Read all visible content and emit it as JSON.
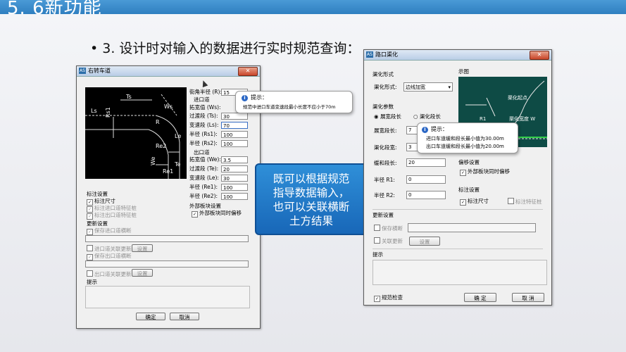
{
  "slide": {
    "header_title": "5. 6新功能",
    "bullet_marker": "•",
    "bullet_text": "3. 设计时对输入的数据进行实时规范查询："
  },
  "left_dialog": {
    "title": "右转车道",
    "params": {
      "corner_radius_label": "街角半径 (R):",
      "corner_radius_value": "15",
      "entry_label": "进口道",
      "widen_label": "拓宽值 (Ws):",
      "taper_label": "过渡段 (Ts):",
      "taper_value": "30",
      "change_label": "变速段 (Ls):",
      "change_value": "70",
      "r1_label": "半径 (Rs1):",
      "r1_value": "100",
      "r2_label": "半径 (Rs2):",
      "r2_value": "100",
      "exit_label": "出口道",
      "e_widen_label": "拓宽值 (We):",
      "e_widen_value": "3.5",
      "e_taper_label": "过渡段 (Te):",
      "e_taper_value": "20",
      "e_change_label": "变速段 (Le):",
      "e_change_value": "30",
      "e_r1_label": "半径 (Re1):",
      "e_r1_value": "100",
      "e_r2_label": "半径 (Re2):",
      "e_r2_value": "100",
      "outer_label": "外部板块设置",
      "outer_follow": "外部板块同时偏移"
    },
    "diagram_labels": {
      "ts": "Ts",
      "ws": "Ws",
      "r": "R",
      "le": "Le",
      "rs1": "Rs1",
      "re2": "Re2",
      "re1": "Re1",
      "ls": "Ls",
      "te": "Te",
      "we": "We"
    },
    "tooltip": {
      "title": "提示：",
      "text": "规范中进口车道变速段最小长度不应小于70m"
    },
    "label_settings": {
      "header": "标注设置",
      "dim": "标注尺寸",
      "entry_feature": "标注进口道特征桩",
      "exit_feature": "标注出口道特征桩"
    },
    "update_settings": {
      "header": "更新设置",
      "save_entry": "保存进口道横断",
      "link_entry": "进口道关联更新",
      "settings_btn": "设置",
      "save_exit": "保存出口道横断",
      "link_exit": "出口道关联更新",
      "settings_btn2": "设置"
    },
    "hint_header": "提示",
    "ok": "确定",
    "cancel": "取消"
  },
  "callout": {
    "lines": [
      "既可以根据规范",
      "指导数据输入，",
      "也可以关联横断",
      "土方结果"
    ]
  },
  "right_dialog": {
    "title": "路口渠化",
    "form_header": "渠化形式",
    "form_label": "渠化形式:",
    "form_value": "边线加宽",
    "preview_header": "示图",
    "params_header": "渠化参数",
    "radio_widen": "展宽段长",
    "radio_other": "渠化段长",
    "widen_len_label": "展宽段长:",
    "widen_len_value": "7",
    "channel_len_label": "渠化段宽:",
    "channel_len_value": "3",
    "taper_len_label": "缓和段长:",
    "taper_len_value": "20",
    "r1_label": "半径 R1:",
    "r1_value": "0",
    "r2_label": "半径 R2:",
    "r2_value": "0",
    "offset_header": "偏移设置",
    "offset_follow": "外部板块同时偏移",
    "label_header": "标注设置",
    "label_dim": "标注尺寸",
    "label_feature": "标注特征桩",
    "update_header": "更新设置",
    "save_section": "保存横断",
    "link_update": "关联更新",
    "settings_btn": "设置",
    "hint_header": "提示",
    "check_label": "规范检查",
    "ok": "确 定",
    "cancel": "取 消",
    "tooltip": {
      "title": "提示：",
      "line1": "进口车道缓和段长最小值为30.00m",
      "line2": "出口车道缓和段长最小值为20.00m"
    },
    "preview_labels": {
      "start": "渠化起点",
      "r1": "R1",
      "width": "渠化宽度 W"
    }
  }
}
